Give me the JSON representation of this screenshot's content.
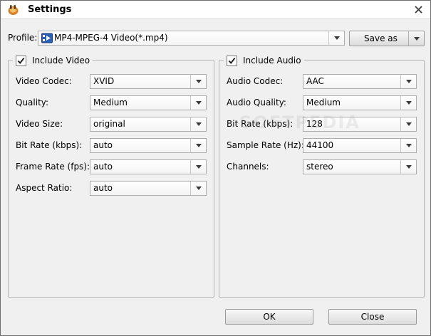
{
  "window": {
    "title": "Settings"
  },
  "profile": {
    "label": "Profile:",
    "value": "MP4-MPEG-4 Video(*.mp4)",
    "save_as_label": "Save as"
  },
  "video": {
    "group_label": "Include Video",
    "checked": true,
    "fields": [
      {
        "label": "Video Codec:",
        "value": "XVID"
      },
      {
        "label": "Quality:",
        "value": "Medium"
      },
      {
        "label": "Video Size:",
        "value": "original"
      },
      {
        "label": "Bit Rate (kbps):",
        "value": "auto"
      },
      {
        "label": "Frame Rate (fps):",
        "value": "auto"
      },
      {
        "label": "Aspect Ratio:",
        "value": "auto"
      }
    ]
  },
  "audio": {
    "group_label": "Include Audio",
    "checked": true,
    "fields": [
      {
        "label": "Audio Codec:",
        "value": "AAC"
      },
      {
        "label": "Audio Quality:",
        "value": "Medium"
      },
      {
        "label": "Bit Rate (kbps):",
        "value": "128"
      },
      {
        "label": "Sample Rate (Hz):",
        "value": "44100"
      },
      {
        "label": "Channels:",
        "value": "stereo"
      }
    ]
  },
  "buttons": {
    "ok": "OK",
    "close": "Close"
  },
  "watermark": "SOFTPEDIA",
  "icons": {
    "app": "settings-app-icon",
    "close": "close-icon",
    "profile": "video-file-icon",
    "dropdown": "chevron-down-icon",
    "checkbox": "checkmark-icon"
  }
}
